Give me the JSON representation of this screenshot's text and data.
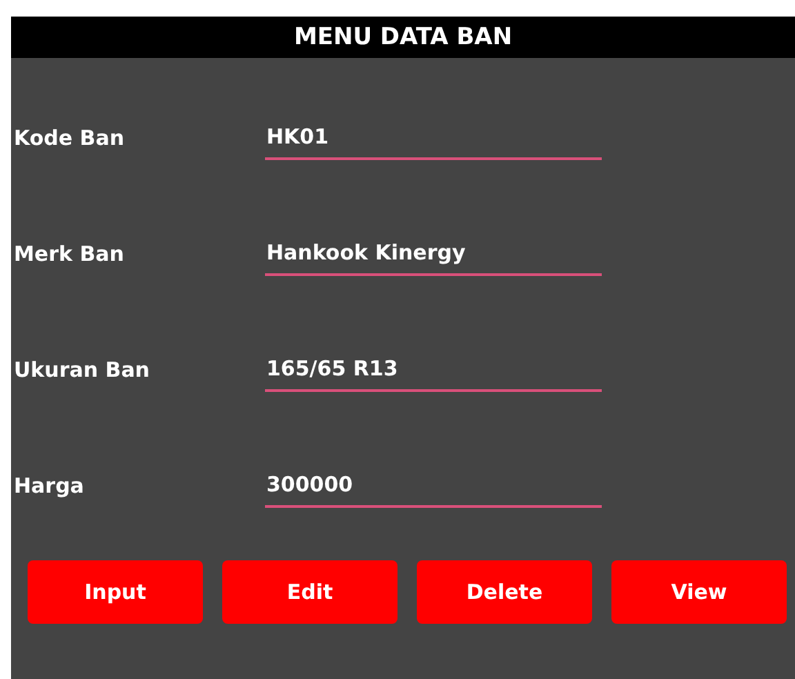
{
  "title": "MENU DATA BAN",
  "fields": [
    {
      "label": "Kode Ban",
      "value": "HK01"
    },
    {
      "label": "Merk Ban",
      "value": "Hankook Kinergy"
    },
    {
      "label": "Ukuran Ban",
      "value": "165/65 R13"
    },
    {
      "label": "Harga",
      "value": "300000"
    }
  ],
  "buttons": [
    "Input",
    "Edit",
    "Delete",
    "View"
  ]
}
